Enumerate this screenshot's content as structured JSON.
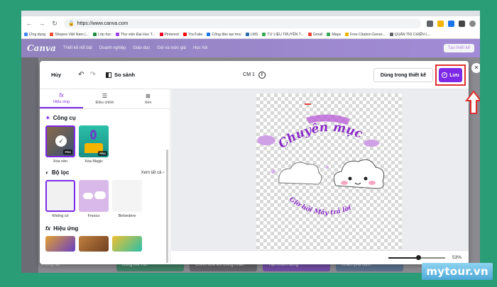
{
  "browser": {
    "url": "https://www.canva.com",
    "bookmarks": [
      "Ứng dụng",
      "Shopee Việt Nam |...",
      "Lớp học",
      "Thư viện Đại Học T...",
      "Pinterest",
      "YouTube",
      "Cổng đào tạo tmu",
      "LMS",
      "TƯ LIỆU TRUYỀN T...",
      "Gmail",
      "Maps",
      "Free Citation Gener...",
      "QUẢN TRỊ CHIẾN L..."
    ]
  },
  "canva_header": {
    "logo": "Canva",
    "menu": [
      "Thiết kế nổi bật",
      "Doanh nghiệp",
      "Giáo dục",
      "Gói và mức giá",
      "Học hỏi"
    ],
    "create_label": "Tạo thiết kế"
  },
  "background": {
    "tiles": [
      "Dùng thử HB",
      "Chỉnh sửa với Đồng nhãn",
      "Tạo nhóm dùng",
      "Khám phá Dịch"
    ],
    "trash": "Thùng rác"
  },
  "modal": {
    "cancel": "Hủy",
    "compare": "So sánh",
    "size_label": "CM 1",
    "use_in_design": "Dùng trong thiết kế",
    "save": "Lưu",
    "tabs": [
      "Hiệu ứng",
      "Điều chỉnh",
      "Xén"
    ],
    "tools_title": "Công cụ",
    "tools": [
      "Xóa nền",
      "Xóa Magic"
    ],
    "filters_title": "Bộ lọc",
    "see_all": "Xem tất cả",
    "filters": [
      "Không có",
      "Fresco",
      "Belvedere"
    ],
    "effects_title": "Hiệu ứng",
    "zoom": "53%",
    "zoom_fraction": 0.53,
    "image_text_top": "Chuyên mục",
    "image_text_bottom": "Giờ hỏi Mây trả lời"
  },
  "brand": "mytour.vn",
  "colors": {
    "accent": "#7d2ae8",
    "highlight": "#e12d2d",
    "frame": "#2a9d77"
  }
}
